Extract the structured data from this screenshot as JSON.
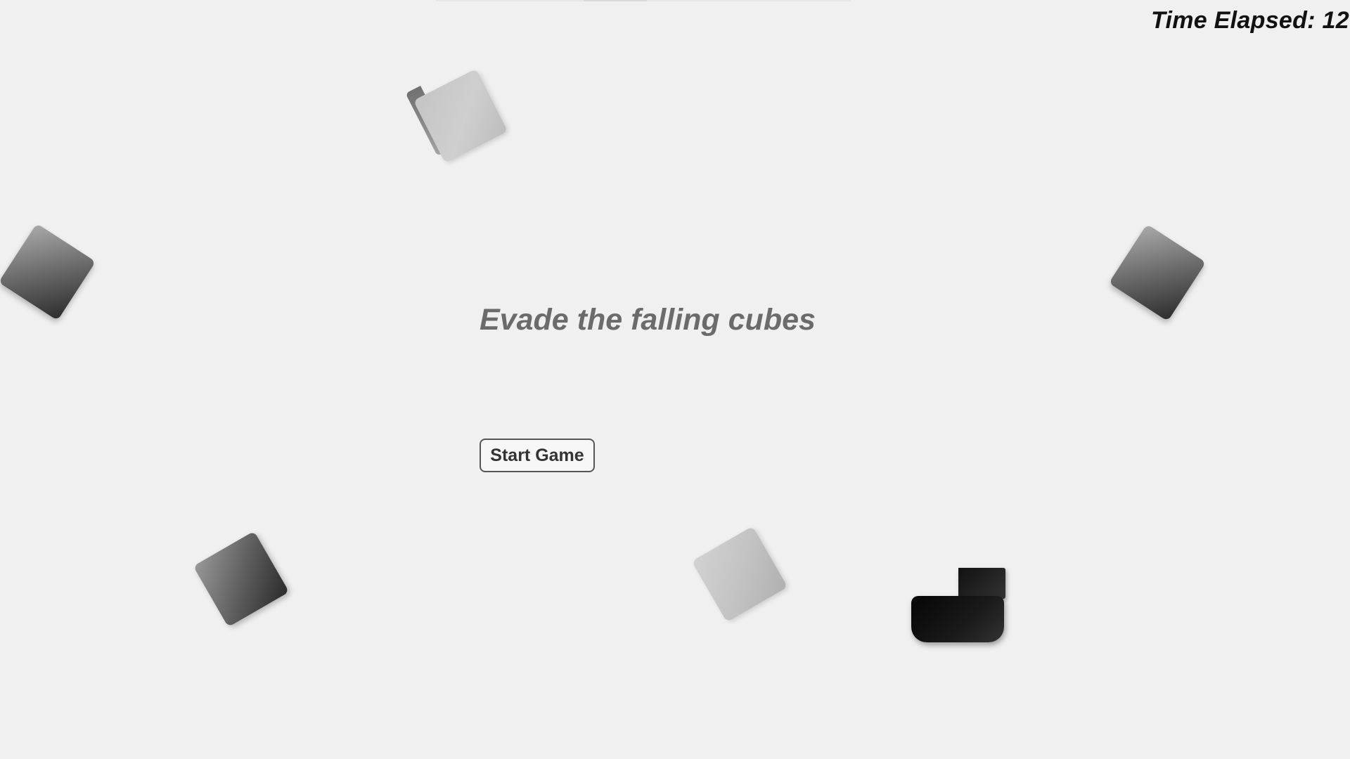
{
  "hud": {
    "timer_text": "Time Elapsed: 12"
  },
  "menu": {
    "title": "Evade the falling cubes",
    "start_button_label": "Start Game"
  },
  "colors": {
    "background": "#f0f0f0",
    "title_text": "#6b6b6b",
    "timer_text": "#111111",
    "player": "#111111"
  }
}
